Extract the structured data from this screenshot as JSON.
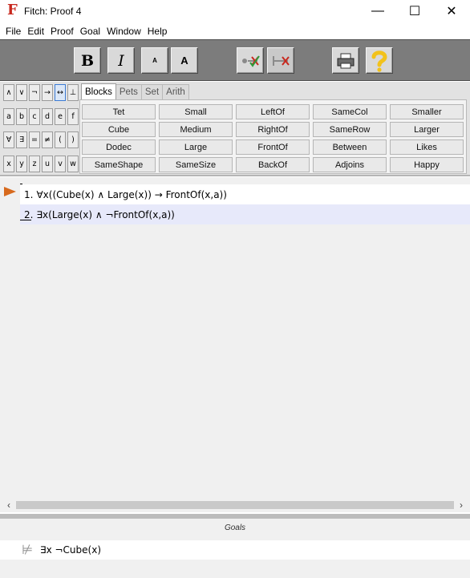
{
  "window": {
    "title": "Fitch: Proof 4",
    "app_icon": "F",
    "controls": {
      "minimize": "—",
      "maximize": "☐",
      "close": "✕"
    }
  },
  "menubar": {
    "items": [
      "File",
      "Edit",
      "Proof",
      "Goal",
      "Window",
      "Help"
    ]
  },
  "toolbar": {
    "bold": "B",
    "italic": "I",
    "font_smaller": "A",
    "font_larger": "A",
    "icons": {
      "verify_all": "check-steps-icon",
      "verify_step": "verify-step-icon",
      "print": "printer-icon",
      "help": "help-question-icon"
    }
  },
  "symbol_palette": {
    "rows": [
      [
        "∧",
        "∨",
        "¬",
        "→",
        "↔",
        "⊥"
      ],
      [
        "a",
        "b",
        "c",
        "d",
        "e",
        "f"
      ],
      [
        "∀",
        "∃",
        "=",
        "≠",
        "(",
        ")"
      ],
      [
        "x",
        "y",
        "z",
        "u",
        "v",
        "w"
      ]
    ],
    "active": "↔"
  },
  "tabs": {
    "items": [
      "Blocks",
      "Pets",
      "Set",
      "Arith"
    ],
    "active": "Blocks"
  },
  "predicates": {
    "rows": [
      [
        "Tet",
        "Small",
        "LeftOf",
        "SameCol",
        "Smaller"
      ],
      [
        "Cube",
        "Medium",
        "RightOf",
        "SameRow",
        "Larger"
      ],
      [
        "Dodec",
        "Large",
        "FrontOf",
        "Between",
        "Likes"
      ],
      [
        "SameShape",
        "SameSize",
        "BackOf",
        "Adjoins",
        "Happy"
      ]
    ]
  },
  "proof": {
    "lines": [
      {
        "num": "1.",
        "formula": "∀x((Cube(x) ∧ Large(x)) → FrontOf(x,a))"
      },
      {
        "num": "2.",
        "formula": "∃x(Large(x) ∧ ¬FrontOf(x,a))"
      }
    ],
    "focus_line": 1
  },
  "scrollbar": {
    "left": "‹",
    "right": "›"
  },
  "goals": {
    "header": "Goals",
    "items": [
      {
        "icon": "goal-unproved-icon",
        "formula": "∃x ¬Cube(x)"
      }
    ]
  },
  "colors": {
    "toolbar_bg": "#7c7c7c",
    "focus_arrow": "#d76a1e",
    "selected_line_bg": "#e7e9fa",
    "active_symbol_border": "#3b7bd4",
    "app_icon": "#c8281e"
  }
}
